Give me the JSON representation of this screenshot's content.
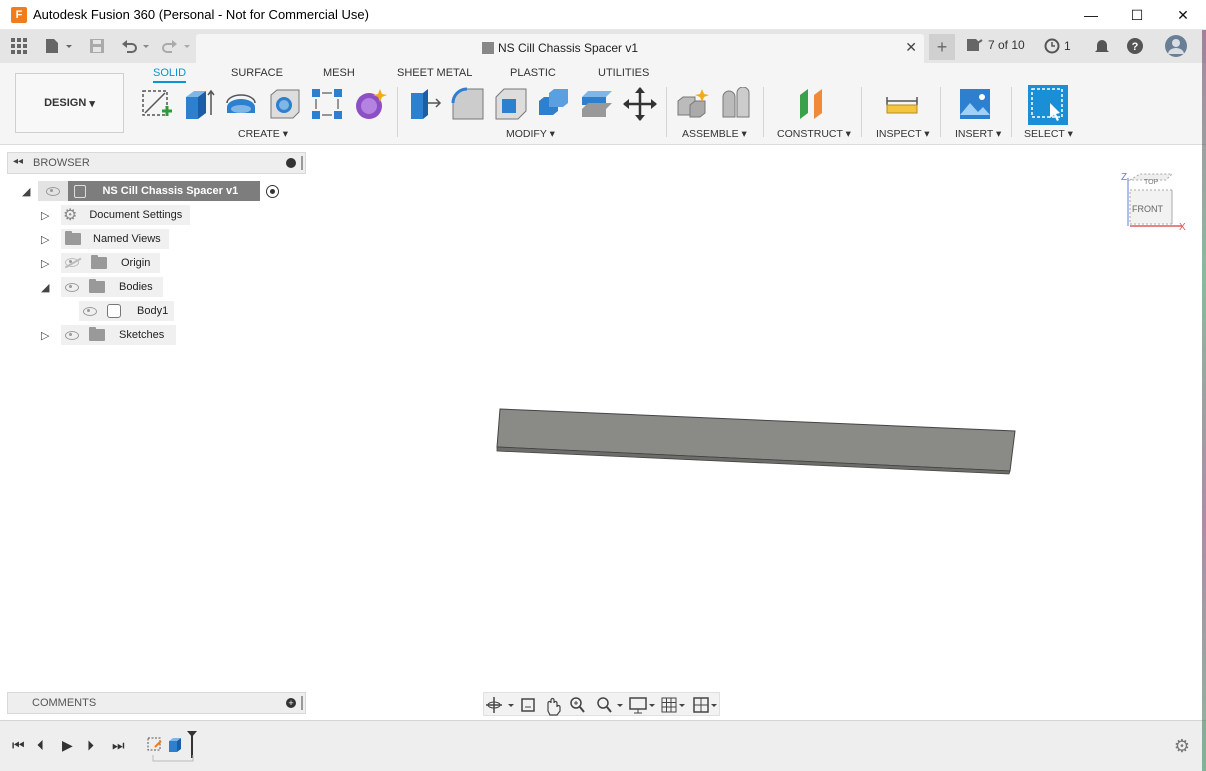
{
  "window": {
    "title": "Autodesk Fusion 360 (Personal - Not for Commercial Use)",
    "app_icon_letter": "F",
    "controls": [
      "minimize",
      "maximize",
      "close"
    ]
  },
  "quick_access": {
    "document_tab_title": "NS Cill Chassis Spacer v1",
    "job_status": "7 of 10",
    "clock_count": "1"
  },
  "toolbar": {
    "workspace": "DESIGN",
    "tabs": [
      "SOLID",
      "SURFACE",
      "MESH",
      "SHEET METAL",
      "PLASTIC",
      "UTILITIES"
    ],
    "active_tab": "SOLID",
    "groups": [
      "CREATE",
      "MODIFY",
      "ASSEMBLE",
      "CONSTRUCT",
      "INSPECT",
      "INSERT",
      "SELECT"
    ]
  },
  "browser": {
    "title": "BROWSER",
    "root": "NS Cill Chassis Spacer v1",
    "items": [
      {
        "label": "Document Settings"
      },
      {
        "label": "Named Views"
      },
      {
        "label": "Origin"
      },
      {
        "label": "Bodies"
      },
      {
        "label": "Body1"
      },
      {
        "label": "Sketches"
      }
    ]
  },
  "viewcube": {
    "top": "TOP",
    "front": "FRONT",
    "z_axis": "Z",
    "x_axis": "X"
  },
  "comments": {
    "title": "COMMENTS"
  },
  "colors": {
    "accent": "#0696d7",
    "body_fill": "#8a8a86",
    "select_blue": "#1a8fd6"
  }
}
